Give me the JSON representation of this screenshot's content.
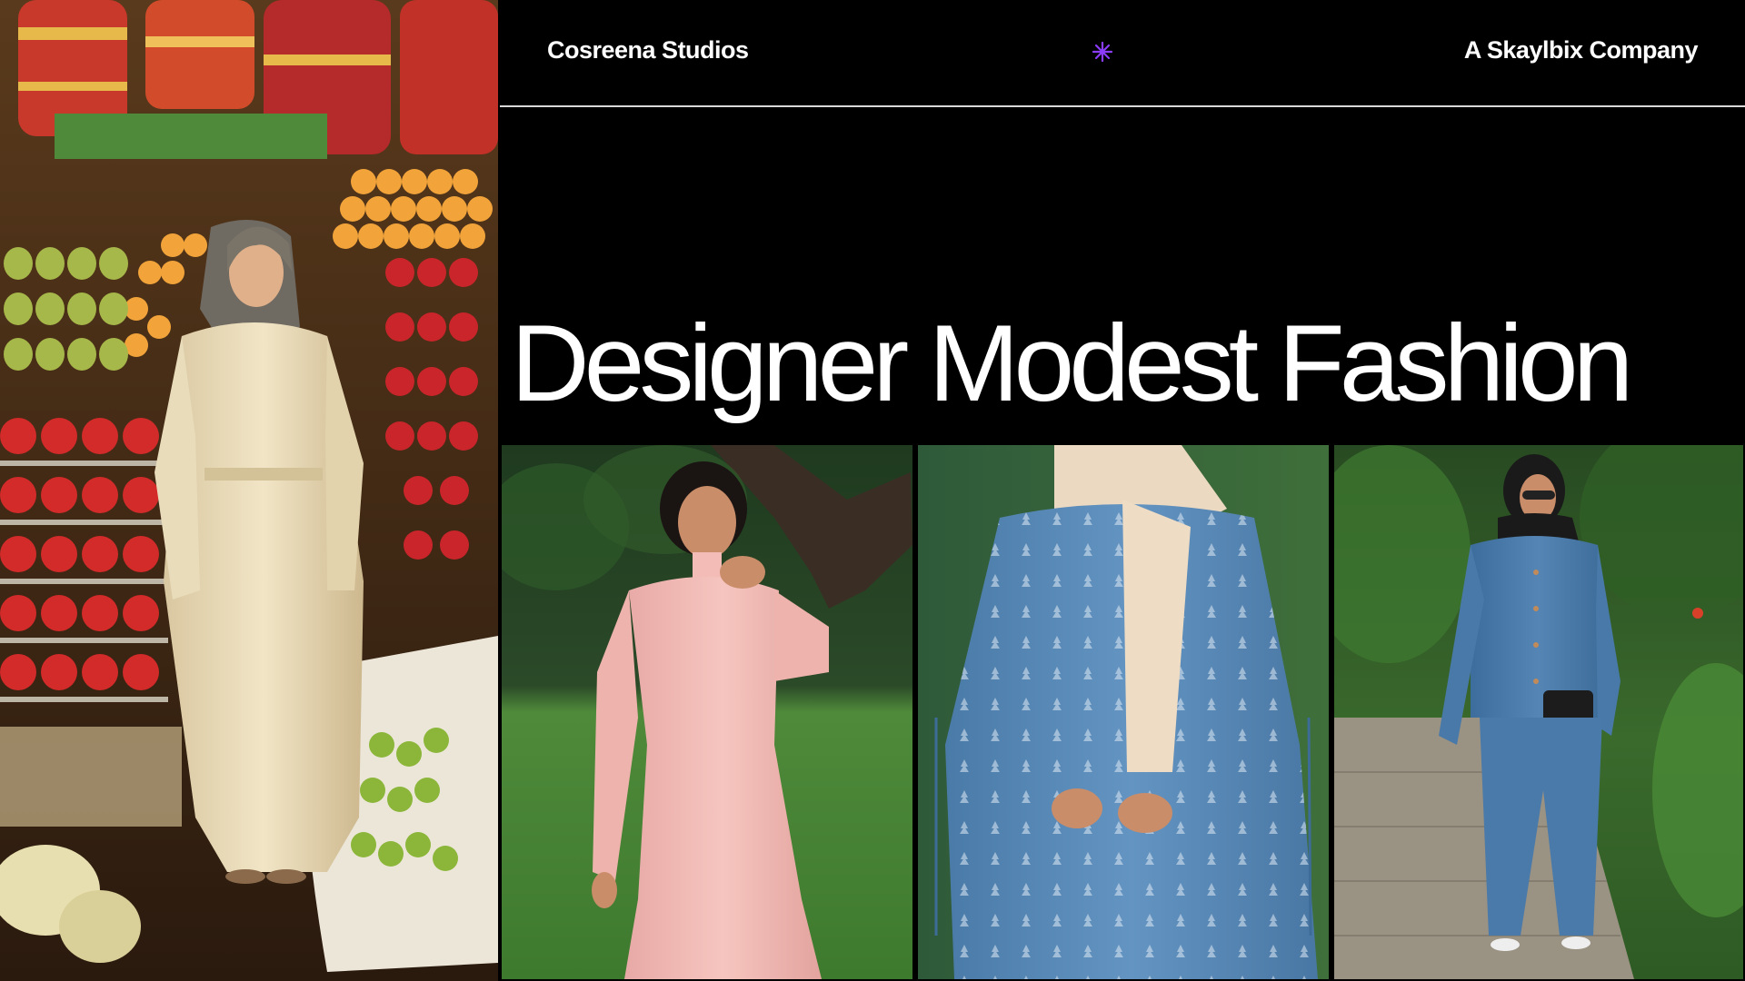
{
  "header": {
    "brand": "Cosreena Studios",
    "company": "A Skaylbix Company",
    "accent_color": "#8b3cf7",
    "center_icon": "sparkle-icon"
  },
  "hero": {
    "title": "Designer Modest Fashion"
  },
  "gallery": {
    "tiles": [
      {
        "name": "market-photo"
      },
      {
        "name": "pink-dress-photo"
      },
      {
        "name": "blue-dress-photo"
      },
      {
        "name": "denim-outfit-photo"
      }
    ]
  }
}
